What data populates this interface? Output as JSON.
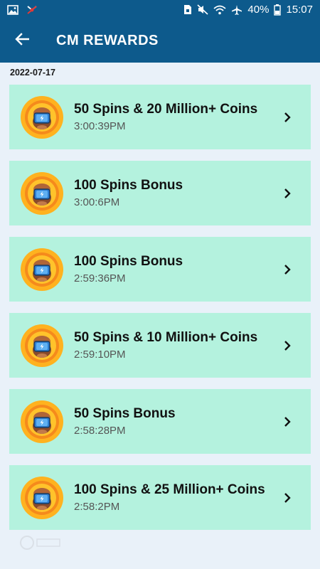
{
  "status_bar": {
    "battery_percent": "40%",
    "time": "15:07",
    "icons_left": [
      "gallery-icon",
      "notification-icon"
    ],
    "icons_right": [
      "sim-icon",
      "mute-icon",
      "wifi-icon",
      "airplane-icon",
      "battery-icon"
    ]
  },
  "app_bar": {
    "back_icon": "arrow-left-icon",
    "title": "CM REWARDS"
  },
  "date": "2022-07-17",
  "rewards": [
    {
      "title": "50 Spins & 20 Million+ Coins",
      "time": "3:00:39PM"
    },
    {
      "title": "100 Spins Bonus",
      "time": "3:00:6PM"
    },
    {
      "title": "100 Spins Bonus",
      "time": "2:59:36PM"
    },
    {
      "title": "50 Spins & 10 Million+ Coins",
      "time": "2:59:10PM"
    },
    {
      "title": "50 Spins Bonus",
      "time": "2:58:28PM"
    },
    {
      "title": "100 Spins & 25 Million+ Coins",
      "time": "2:58:2PM"
    }
  ],
  "colors": {
    "primary": "#0d5a8c",
    "background": "#e9f1f9",
    "card": "#b4f2de",
    "coin_outer": "#ffb21f",
    "coin_inner": "#f58a1c"
  }
}
